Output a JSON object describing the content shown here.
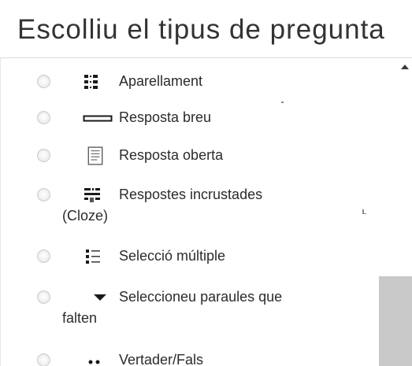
{
  "dialog": {
    "title": "Escolliu el tipus de pregunta"
  },
  "question_types": [
    {
      "label": "Aparellament",
      "icon": "matching-icon",
      "selected": false
    },
    {
      "label": "Resposta breu",
      "icon": "short-answer-icon",
      "selected": false
    },
    {
      "label": "Resposta oberta",
      "icon": "essay-icon",
      "selected": false
    },
    {
      "label": "Respostes incrustades",
      "label_cont": "(Cloze)",
      "icon": "cloze-icon",
      "selected": false
    },
    {
      "label": "Selecció múltiple",
      "icon": "multiple-choice-icon",
      "selected": false
    },
    {
      "label": "Seleccioneu paraules que",
      "label_cont": "falten",
      "icon": "dropdown-icon",
      "selected": false
    },
    {
      "label": "Vertader/Fals",
      "icon": "true-false-icon",
      "selected": false
    }
  ],
  "colors": {
    "text": "#2b2b2b",
    "radio_border": "#cfcfcf",
    "scrollbar_thumb": "#c9c9c9",
    "icon": "#1a1a1a"
  }
}
